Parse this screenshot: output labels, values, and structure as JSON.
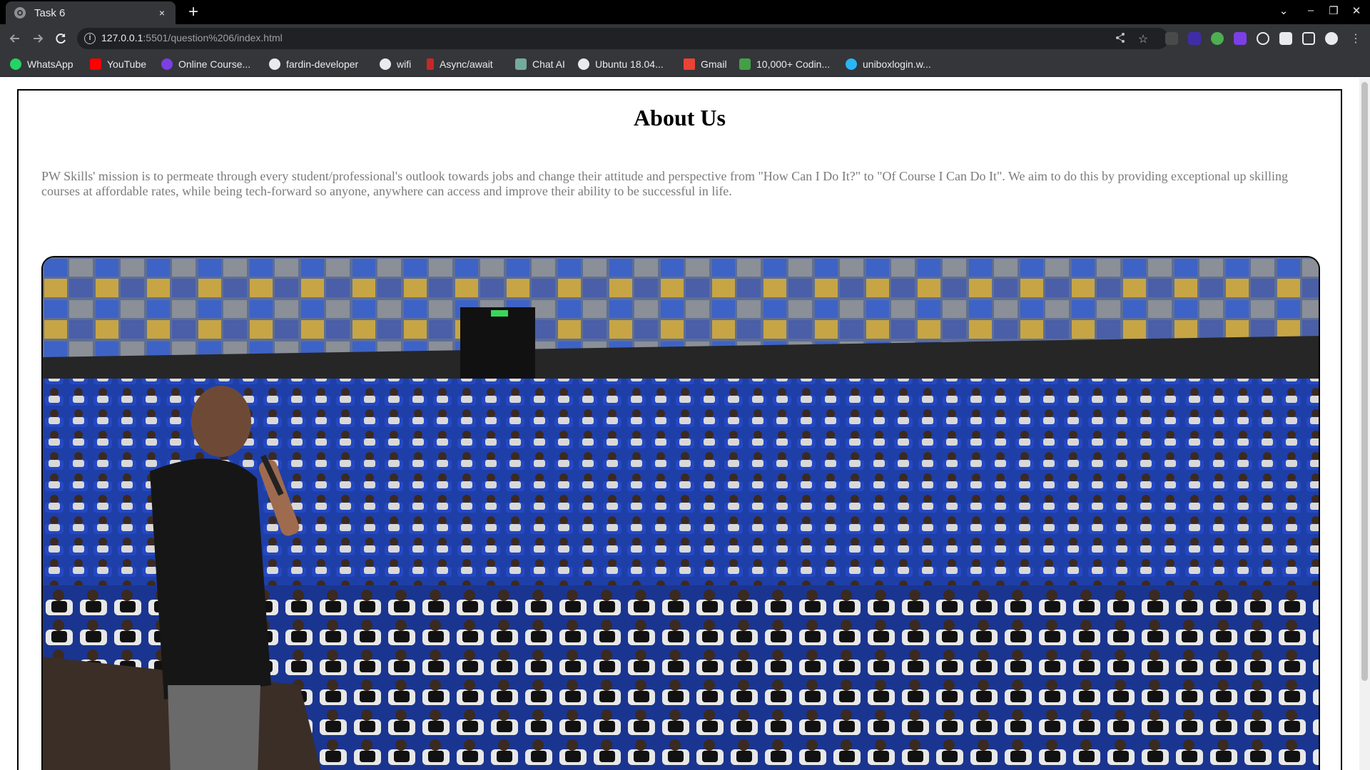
{
  "browser": {
    "tab_title": "Task 6",
    "tab_close": "×",
    "new_tab": "+",
    "window_controls": {
      "menu": "⌄",
      "minimize": "–",
      "restore": "❐",
      "close": "✕"
    },
    "url_host": "127.0.0.1",
    "url_rest": ":5501/question%206/index.html",
    "bookmarks": [
      {
        "label": "WhatsApp",
        "icon": "whatsapp-icon",
        "color": "#25d366"
      },
      {
        "label": "YouTube",
        "icon": "youtube-icon",
        "color": "#ff0000"
      },
      {
        "label": "Online Course...",
        "icon": "course-icon",
        "color": "#7b3fe4"
      },
      {
        "label": "fardin-developer",
        "icon": "github-icon",
        "color": "#e8eaed"
      },
      {
        "label": "wifi",
        "icon": "globe-icon",
        "color": "#e8eaed"
      },
      {
        "label": "Async/await",
        "icon": "async-icon",
        "color": "#c62828"
      },
      {
        "label": "Chat AI",
        "icon": "chatai-icon",
        "color": "#74aa9c"
      },
      {
        "label": "Ubuntu 18.04...",
        "icon": "github-icon",
        "color": "#e8eaed"
      },
      {
        "label": "Gmail",
        "icon": "gmail-icon",
        "color": "#ea4335"
      },
      {
        "label": "10,000+ Codin...",
        "icon": "coding-icon",
        "color": "#43a047"
      },
      {
        "label": "uniboxlogin.w...",
        "icon": "cloud-icon",
        "color": "#29b6f6"
      }
    ]
  },
  "page": {
    "title": "About Us",
    "mission": "PW Skills' mission is to permeate through every student/professional's outlook towards jobs and change their attitude and perspective from \"How Can I Do It?\" to \"Of Course I Can Do It\". We aim to do this by providing exceptional up skilling courses at affordable rates, while being tech-forward so anyone, anywhere can access and improve their ability to be successful in life.",
    "photo_subject": "speaker addressing a full auditorium of students in blue seats"
  },
  "colors": {
    "chrome_dark": "#000000",
    "chrome_toolbar": "#35363a",
    "mission_text": "#7b7b7b",
    "seat_blue": "#1e3fa8"
  }
}
